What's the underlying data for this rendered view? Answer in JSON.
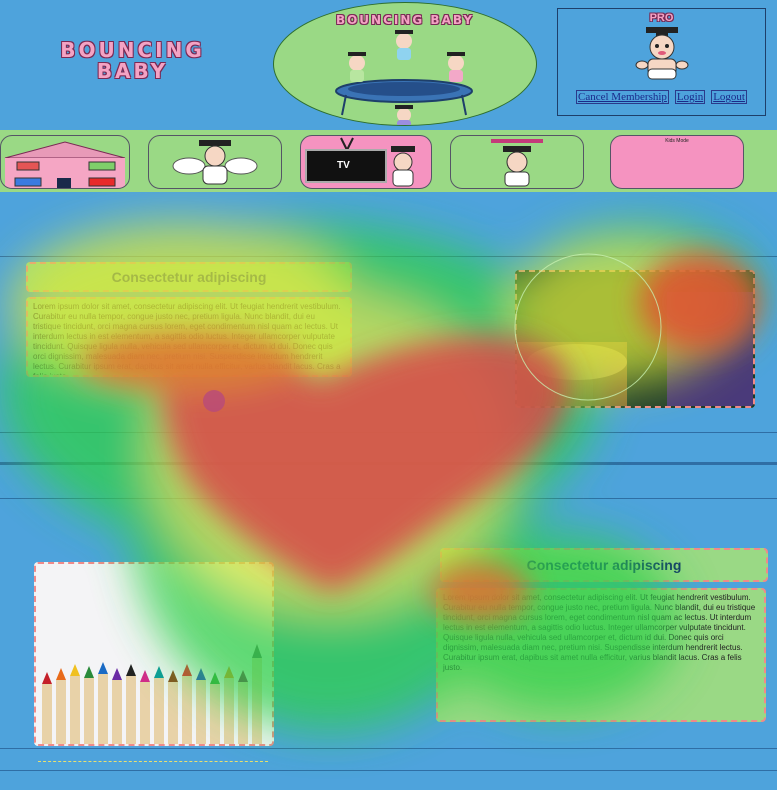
{
  "header": {
    "logo_text": "BOUNCING BABY",
    "banner_title": "BOUNCING BABY",
    "account": {
      "badge": "PRO",
      "links": [
        "Cancel Membership",
        "Login",
        "Logout"
      ]
    }
  },
  "nav": {
    "items": [
      {
        "name": "house",
        "label": ""
      },
      {
        "name": "baby-wings",
        "label": ""
      },
      {
        "name": "tv",
        "label": "TV"
      },
      {
        "name": "baby-grad",
        "label": ""
      },
      {
        "name": "kids-mode",
        "label": "Kids Mode"
      }
    ]
  },
  "sections": [
    {
      "heading": "Consectetur adipiscing",
      "text": "Lorem ipsum dolor sit amet, consectetur adipiscing elit. Ut feugiat hendrerit vestibulum. Curabitur eu nulla tempor, congue justo nec, pretium ligula. Nunc blandit, dui eu tristique tincidunt, orci magna cursus lorem, eget condimentum nisl quam ac lectus. Ut interdum lectus in est elementum, a sagittis odio luctus. Integer ullamcorper vulputate tincidunt. Quisque ligula nulla, vehicula sed ullamcorper et, dictum id dui. Donec quis orci dignissim, malesuada diam nec, pretium nisi. Suspendisse interdum hendrerit lectus. Curabitur ipsum erat, dapibus sit amet nulla efficitur, varius blandit lacus. Cras a felis justo."
    },
    {
      "heading": "Consectetur adipiscing",
      "text": "Lorem ipsum dolor sit amet, consectetur adipiscing elit. Ut feugiat hendrerit vestibulum. Curabitur eu nulla tempor, congue justo nec, pretium ligula. Nunc blandit, dui eu tristique tincidunt, orci magna cursus lorem, eget condimentum nisl quam ac lectus. Ut interdum lectus in est elementum, a sagittis odio luctus. Integer ullamcorper vulputate tincidunt. Quisque ligula nulla, vehicula sed ullamcorper et, dictum id dui. Donec quis orci dignissim, malesuada diam nec, pretium nisi. Suspendisse interdum hendrerit lectus. Curabitur ipsum erat, dapibus sit amet nulla efficitur, varius blandit lacus. Cras a felis justo."
    }
  ],
  "colors": {
    "page_bg": "#4ea3dc",
    "panel_green": "#9ad985",
    "accent_pink": "#f593c0",
    "dash_border": "#f08a8a",
    "heading_text": "#12306a"
  },
  "overlay": {
    "type": "eye-tracking heatmap"
  }
}
